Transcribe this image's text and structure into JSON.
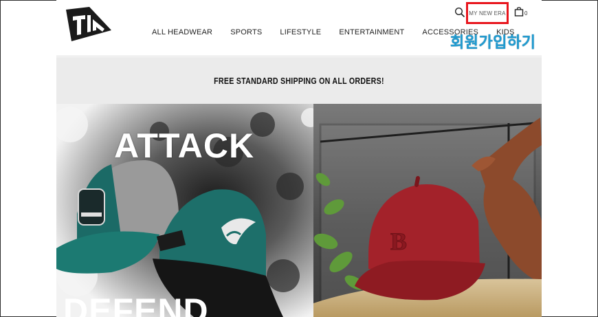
{
  "header": {
    "nav": [
      "ALL HEADWEAR",
      "SPORTS",
      "LIFESTYLE",
      "ENTERTAINMENT",
      "ACCESSORIES",
      "KIDS"
    ],
    "account_link": "MY NEW ERA",
    "cart_count": "0",
    "annotation_label": "회원가입하기",
    "icons": {
      "search": "search-icon",
      "cart": "shopping-bag-icon",
      "logo": "new-era-flag-logo"
    }
  },
  "banner": {
    "text": "FREE STANDARD SHIPPING ON ALL ORDERS!"
  },
  "hero": {
    "left": {
      "title_top": "ATTACK",
      "title_bottom": "DEFEND"
    }
  },
  "colors": {
    "highlight": "#e8141c",
    "annotation": "#1f9bd1",
    "banner_bg": "#ebebeb"
  }
}
